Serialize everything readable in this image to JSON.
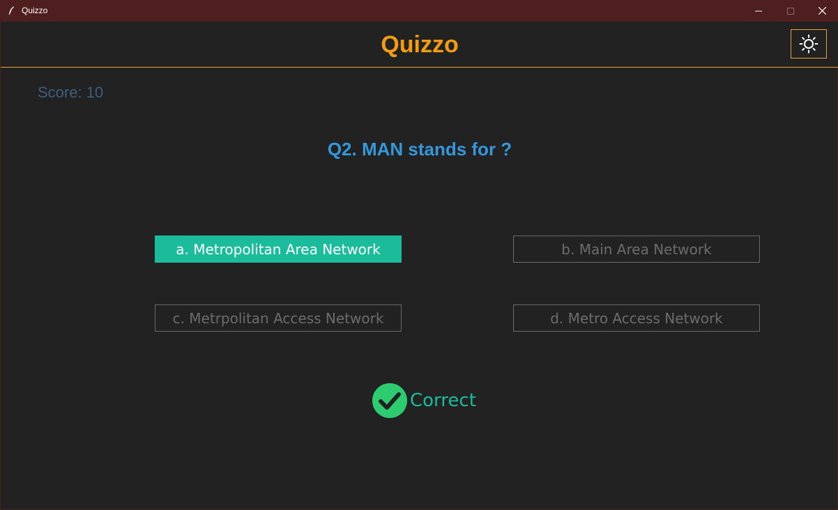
{
  "window": {
    "title": "Quizzo",
    "controls": [
      "minimize-icon",
      "maximize-icon",
      "close-icon"
    ]
  },
  "header": {
    "heading": "Quizzo",
    "theme_toggle_icon": "sun-icon"
  },
  "score": {
    "text": "Score: 10"
  },
  "question": {
    "text": "Q2. MAN stands for ?"
  },
  "options": [
    {
      "label": "a. Metropolitan Area Network",
      "selected": true
    },
    {
      "label": "b. Main Area Network",
      "selected": false
    },
    {
      "label": "c. Metrpolitan Access Network",
      "selected": false
    },
    {
      "label": "d. Metro Access Network",
      "selected": false
    }
  ],
  "result": {
    "icon": "check-circle-icon",
    "text": "Correct"
  },
  "colors": {
    "accent": "#f39c12",
    "question": "#3498db",
    "correct": "#1abc9c",
    "check_badge": "#2ecc71",
    "titlebar": "#4f1f1f",
    "background": "#222222"
  }
}
